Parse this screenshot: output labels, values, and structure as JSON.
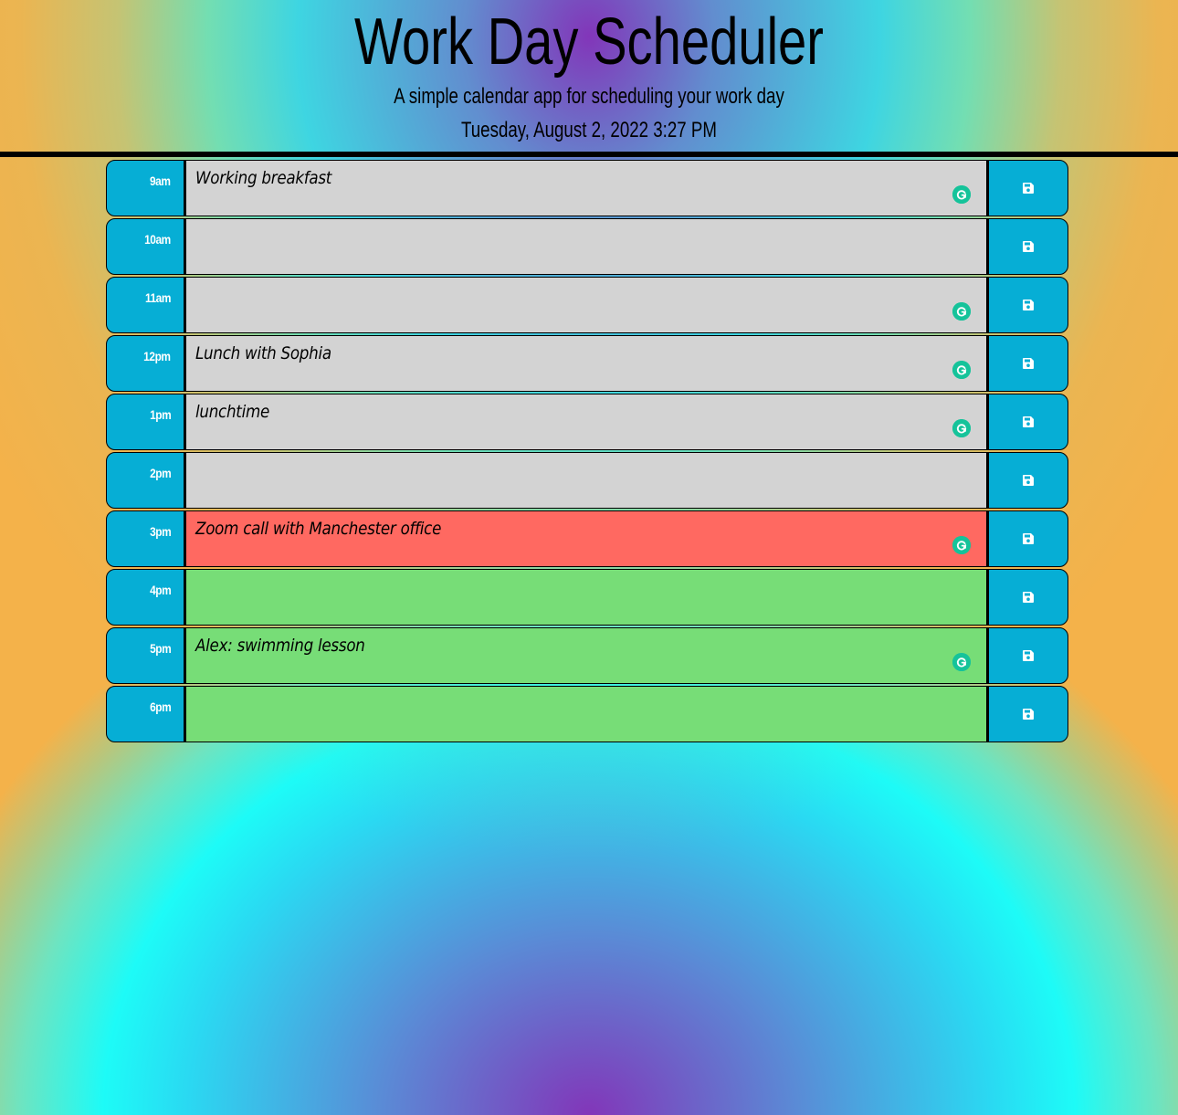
{
  "header": {
    "title": "Work Day Scheduler",
    "lead": "A simple calendar app for scheduling your work day",
    "current_date": "Tuesday, August 2, 2022 3:27 PM"
  },
  "colors": {
    "past": "#d3d3d3",
    "present": "#ff6961",
    "future": "#77dd77",
    "hour_block": "#06aed5",
    "grammarly": "#15c39a"
  },
  "save_icon": "floppy-disk-icon",
  "rows": [
    {
      "hour": "9am",
      "text": "Working breakfast",
      "state": "past",
      "grammarly": true
    },
    {
      "hour": "10am",
      "text": "",
      "state": "past",
      "grammarly": false
    },
    {
      "hour": "11am",
      "text": "",
      "state": "past",
      "grammarly": true
    },
    {
      "hour": "12pm",
      "text": "Lunch with Sophia",
      "state": "past",
      "grammarly": true
    },
    {
      "hour": "1pm",
      "text": "lunchtime",
      "state": "past",
      "grammarly": true
    },
    {
      "hour": "2pm",
      "text": "",
      "state": "past",
      "grammarly": false
    },
    {
      "hour": "3pm",
      "text": "Zoom call with Manchester office",
      "state": "present",
      "grammarly": true
    },
    {
      "hour": "4pm",
      "text": "",
      "state": "future",
      "grammarly": false
    },
    {
      "hour": "5pm",
      "text": "Alex: swimming lesson",
      "state": "future",
      "grammarly": true
    },
    {
      "hour": "6pm",
      "text": "",
      "state": "future",
      "grammarly": false
    }
  ]
}
